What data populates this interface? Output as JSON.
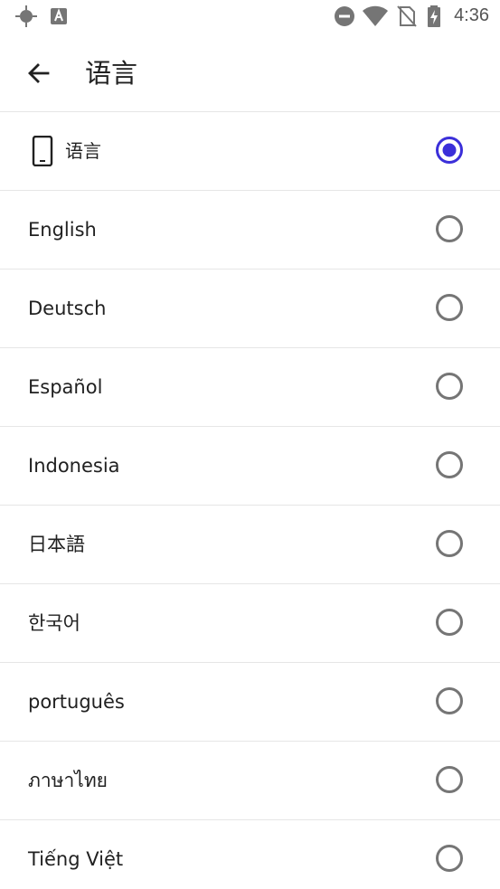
{
  "status_bar": {
    "time": "4:36",
    "icons": [
      "location-icon",
      "keyboard-a-icon",
      "do-not-disturb-icon",
      "wifi-icon",
      "no-sim-icon",
      "battery-charging-icon"
    ]
  },
  "app_bar": {
    "title": "语言",
    "back_icon": "arrow-back-icon"
  },
  "languages": [
    {
      "label": "语言",
      "icon": "phone-icon",
      "selected": true
    },
    {
      "label": "English",
      "selected": false
    },
    {
      "label": "Deutsch",
      "selected": false
    },
    {
      "label": "Español",
      "selected": false
    },
    {
      "label": "Indonesia",
      "selected": false
    },
    {
      "label": "日本語",
      "selected": false
    },
    {
      "label": "한국어",
      "selected": false
    },
    {
      "label": "português",
      "selected": false
    },
    {
      "label": "ภาษาไทย",
      "selected": false
    },
    {
      "label": "Tiếng Việt",
      "selected": false
    }
  ],
  "colors": {
    "accent": "#3b2fd9",
    "radio_unselected": "#757575",
    "divider": "#e6e6e6",
    "status_icons": "#757575"
  }
}
